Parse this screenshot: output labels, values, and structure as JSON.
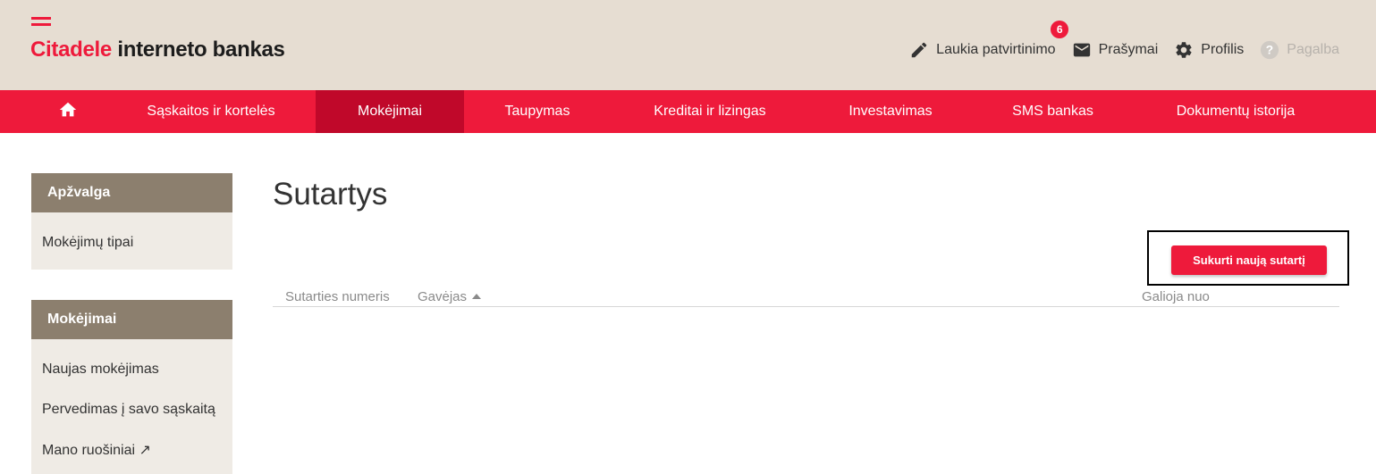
{
  "header": {
    "logo_brand": "Citadele",
    "logo_rest": " interneto bankas",
    "links": {
      "pending": {
        "label": "Laukia patvirtinimo",
        "badge": "6",
        "icon": "pencil-icon"
      },
      "requests": {
        "label": "Prašymai",
        "icon": "envelope-icon"
      },
      "profile": {
        "label": "Profilis",
        "icon": "gear-icon"
      },
      "help": {
        "label": "Pagalba",
        "icon": "help-circle-icon"
      }
    }
  },
  "nav": {
    "home_icon": "home-icon",
    "items": [
      {
        "label": "Sąskaitos ir kortelės"
      },
      {
        "label": "Mokėjimai",
        "active": true
      },
      {
        "label": "Taupymas"
      },
      {
        "label": "Kreditai ir lizingas"
      },
      {
        "label": "Investavimas"
      },
      {
        "label": "SMS bankas"
      },
      {
        "label": "Dokumentų istorija"
      }
    ]
  },
  "sidebar": {
    "sections": [
      {
        "title": "Apžvalga",
        "items": [
          {
            "label": "Mokėjimų tipai"
          }
        ]
      },
      {
        "title": "Mokėjimai",
        "items": [
          {
            "label": "Naujas mokėjimas"
          },
          {
            "label": "Pervedimas į savo sąskaitą"
          },
          {
            "label": "Mano ruošiniai ↗"
          }
        ]
      }
    ]
  },
  "main": {
    "title": "Sutartys",
    "new_button": "Sukurti naują sutartį",
    "columns": {
      "number": "Sutarties numeris",
      "payee": "Gavėjas",
      "valid_from": "Galioja nuo"
    }
  },
  "colors": {
    "brand_red": "#ee1a3b",
    "nav_active": "#c0082a",
    "header_bg": "#e6ddd2",
    "sidebar_head": "#8c7f6e",
    "sidebar_bg": "#efebe5"
  }
}
